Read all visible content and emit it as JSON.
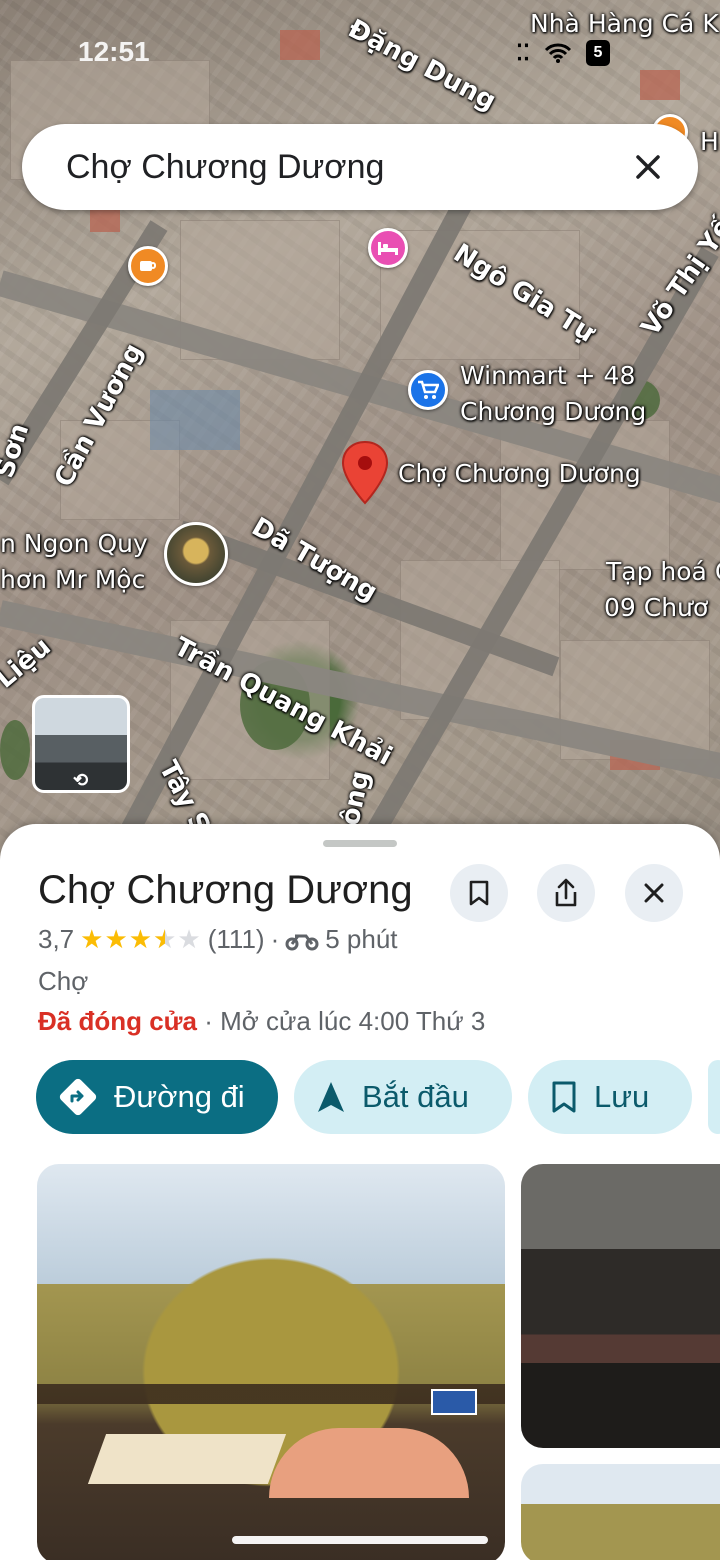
{
  "status_bar": {
    "time": "12:51",
    "battery": "5"
  },
  "search": {
    "query": "Chợ Chương Dương",
    "close_icon": "close-icon"
  },
  "map": {
    "streets": [
      "Đặng Dung",
      "Ngô Gia Tự",
      "Võ Thị Yến",
      "Cần Vương",
      "Sơn",
      "Dã Tượng",
      "Trần Quang Khải",
      "Tây Sơn",
      "Liệu",
      "ông"
    ],
    "pois": {
      "top_right": "Nhà Hàng Cá K",
      "top_right_2": "H",
      "winmart": [
        "Winmart + 48",
        "Chương Dương"
      ],
      "selected": "Chợ Chương Dương",
      "left_1": "n Ngon Quy",
      "left_2": "hơn Mr Mộc",
      "right_1": "Tạp hoá C",
      "right_2": "09 Chươ"
    }
  },
  "place": {
    "title": "Chợ Chương Dương",
    "rating": "3,7",
    "reviews": "(111)",
    "separator": "·",
    "travel_time": "5 phút",
    "category": "Chợ",
    "status_closed": "Đã đóng cửa",
    "status_open_info": "· Mở cửa lúc 4:00 Thứ 3",
    "stars_filled": 3.5,
    "stars_total": 5
  },
  "actions": {
    "directions": "Đường đi",
    "start": "Bắt đầu",
    "save": "Lưu"
  },
  "colors": {
    "primary": "#0b6e83",
    "secondary_bg": "#d3eef4",
    "closed_red": "#d93025",
    "star": "#fbbc04",
    "pin_red": "#ea4335"
  }
}
